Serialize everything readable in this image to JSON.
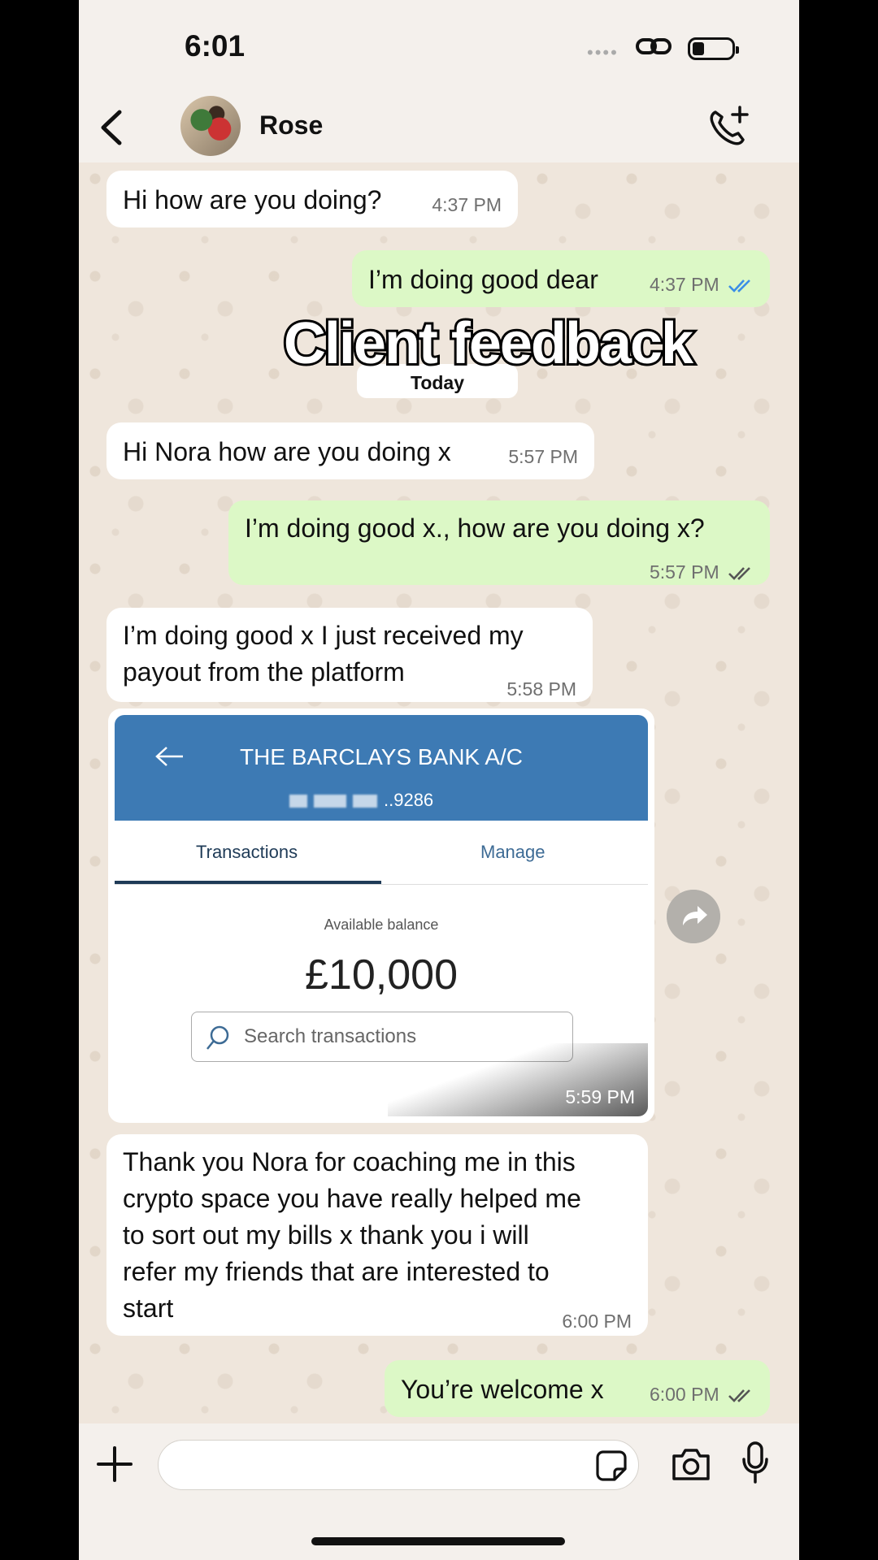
{
  "status_bar": {
    "time": "6:01"
  },
  "header": {
    "contact_name": "Rose"
  },
  "overlay": {
    "title": "Client feedback"
  },
  "date_divider": "Today",
  "messages": [
    {
      "direction": "in",
      "text": "Hi how are you doing?",
      "time": "4:37 PM"
    },
    {
      "direction": "out",
      "text": "I’m doing good dear",
      "time": "4:37 PM",
      "status": "read"
    },
    {
      "direction": "in",
      "text": "Hi Nora how are you doing x",
      "time": "5:57 PM"
    },
    {
      "direction": "out",
      "text": "I’m doing good x.,  how are you doing x?",
      "time": "5:57 PM",
      "status": "delivered"
    },
    {
      "direction": "in",
      "text_lines": [
        "I’m doing good x  I just received my",
        "payout from the platform"
      ],
      "time": "5:58 PM"
    },
    {
      "direction": "in",
      "text_lines": [
        "Thank you Nora for coaching me in this",
        "crypto space you have really helped me",
        "to sort out my bills x thank you i will",
        "refer my friends that are interested to",
        "start"
      ],
      "time": "6:00 PM"
    },
    {
      "direction": "out",
      "text": "You’re welcome x",
      "time": "6:00 PM",
      "status": "delivered"
    }
  ],
  "image_message": {
    "time": "5:59 PM",
    "bank_title": "THE BARCLAYS BANK A/C",
    "account_suffix": "..9286",
    "tabs": [
      "Transactions",
      "Manage"
    ],
    "available_label": "Available balance",
    "balance": "£10,000",
    "search_placeholder": "Search transactions"
  },
  "colors": {
    "outgoing_bubble": "#dcf8c6",
    "incoming_bubble": "#ffffff",
    "read_ticks": "#3b8ee6",
    "bank_header": "#3d7ab4"
  }
}
